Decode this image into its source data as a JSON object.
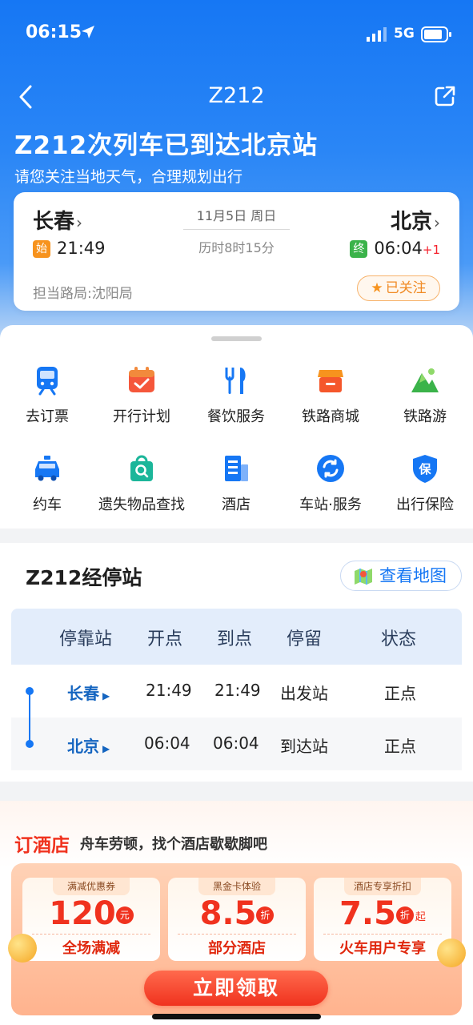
{
  "status_bar": {
    "time": "06:15",
    "network": "5G"
  },
  "nav": {
    "title": "Z212"
  },
  "banner": {
    "title": "Z212次列车已到达北京站",
    "subtitle": "请您关注当地天气，合理规划出行"
  },
  "trip": {
    "from": "长春",
    "to": "北京",
    "from_badge": "始",
    "to_badge": "终",
    "dep_time": "21:49",
    "arr_time": "06:04",
    "arr_day_offset": "+1",
    "date": "11月5日 周日",
    "duration": "历时8时15分",
    "bureau": "担当路局:沈阳局",
    "follow_label": "已关注"
  },
  "services": [
    {
      "label": "去订票",
      "icon": "train-icon"
    },
    {
      "label": "开行计划",
      "icon": "calendar-icon"
    },
    {
      "label": "餐饮服务",
      "icon": "fork-knife-icon"
    },
    {
      "label": "铁路商城",
      "icon": "shop-icon"
    },
    {
      "label": "铁路游",
      "icon": "mountain-icon"
    },
    {
      "label": "约车",
      "icon": "taxi-icon"
    },
    {
      "label": "遗失物品查找",
      "icon": "lost-bag-icon"
    },
    {
      "label": "酒店",
      "icon": "hotel-icon"
    },
    {
      "label": "车站·服务",
      "icon": "station-service-icon"
    },
    {
      "label": "出行保险",
      "icon": "insurance-shield-icon"
    }
  ],
  "stops": {
    "title": "Z212经停站",
    "map_button": "查看地图",
    "headers": [
      "停靠站",
      "开点",
      "到点",
      "停留",
      "状态"
    ],
    "rows": [
      {
        "station": "长春",
        "dep": "21:49",
        "arr": "21:49",
        "stay": "出发站",
        "status": "正点"
      },
      {
        "station": "北京",
        "dep": "06:04",
        "arr": "06:04",
        "stay": "到达站",
        "status": "正点"
      }
    ]
  },
  "hotel": {
    "title": "订酒店",
    "subtitle": "舟车劳顿，找个酒店歇歇脚吧",
    "coupons": [
      {
        "tag": "满减优惠券",
        "value": "120",
        "unit": "元",
        "suffix": "",
        "desc": "全场满减"
      },
      {
        "tag": "黑金卡体验",
        "value": "8.5",
        "unit": "折",
        "suffix": "",
        "desc": "部分酒店"
      },
      {
        "tag": "酒店专享折扣",
        "value": "7.5",
        "unit": "折",
        "suffix": "起",
        "desc": "火车用户专享"
      }
    ],
    "claim_button": "立即领取"
  },
  "colors": {
    "brand_blue": "#1677f4",
    "accent_red": "#f0321e",
    "badge_orange": "#f7931e",
    "badge_green": "#3bb34a"
  }
}
